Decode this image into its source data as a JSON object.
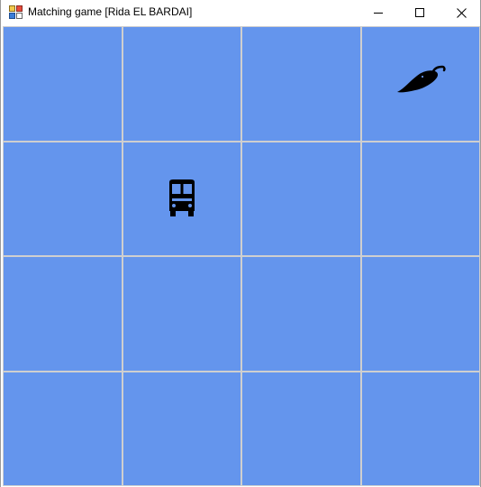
{
  "window": {
    "title": "Matching game [Rida EL BARDAI]"
  },
  "board": {
    "rows": 4,
    "columns": 4,
    "tile_color": "#6495ED",
    "tiles": [
      {
        "icon": ""
      },
      {
        "icon": ""
      },
      {
        "icon": ""
      },
      {
        "icon": "chili-pepper-icon"
      },
      {
        "icon": ""
      },
      {
        "icon": "bus-icon"
      },
      {
        "icon": ""
      },
      {
        "icon": ""
      },
      {
        "icon": ""
      },
      {
        "icon": ""
      },
      {
        "icon": ""
      },
      {
        "icon": ""
      },
      {
        "icon": ""
      },
      {
        "icon": ""
      },
      {
        "icon": ""
      },
      {
        "icon": ""
      }
    ]
  },
  "colors": {
    "tile": "#6495ED",
    "grid_line": "#cfcfcf",
    "icon": "#000000"
  }
}
